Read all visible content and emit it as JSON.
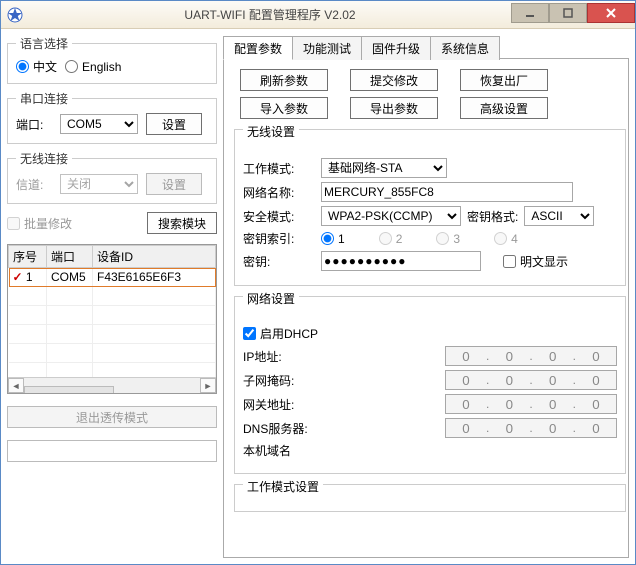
{
  "window": {
    "title": "UART-WIFI 配置管理程序 V2.02"
  },
  "left": {
    "lang_legend": "语言选择",
    "lang_cn": "中文",
    "lang_en": "English",
    "serial_legend": "串口连接",
    "port_label": "端口:",
    "port_value": "COM5",
    "serial_set": "设置",
    "wifi_legend": "无线连接",
    "channel_label": "信道:",
    "channel_value": "关闭",
    "wifi_set": "设置",
    "batch_label": "批量修改",
    "search_btn": "搜索模块",
    "table": {
      "cols": [
        "序号",
        "端口",
        "设备ID"
      ],
      "row": {
        "idx": "1",
        "port": "COM5",
        "devid": "F43E6165E6F3"
      }
    },
    "exit": "退出透传模式",
    "status": ""
  },
  "tabs": {
    "t1": "配置参数",
    "t2": "功能测试",
    "t3": "固件升级",
    "t4": "系统信息"
  },
  "btns": {
    "refresh": "刷新参数",
    "submit": "提交修改",
    "factory": "恢复出厂",
    "import": "导入参数",
    "export": "导出参数",
    "adv": "高级设置"
  },
  "wifi": {
    "legend": "无线设置",
    "mode_label": "工作模式:",
    "mode_value": "基础网络-STA",
    "ssid_label": "网络名称:",
    "ssid_value": "MERCURY_855FC8",
    "sec_label": "安全模式:",
    "sec_value": "WPA2-PSK(CCMP)",
    "keyfmt_label": "密钥格式:",
    "keyfmt_value": "ASCII",
    "keyidx_label": "密钥索引:",
    "k1": "1",
    "k2": "2",
    "k3": "3",
    "k4": "4",
    "pwd_label": "密钥:",
    "pwd_value": "●●●●●●●●●●",
    "plain_label": "明文显示"
  },
  "net": {
    "legend": "网络设置",
    "dhcp_label": "启用DHCP",
    "ip_label": "IP地址:",
    "mask_label": "子网掩码:",
    "gw_label": "网关地址:",
    "dns_label": "DNS服务器:",
    "host_label": "本机域名",
    "oct": "0"
  },
  "workmode": {
    "legend": "工作模式设置"
  }
}
